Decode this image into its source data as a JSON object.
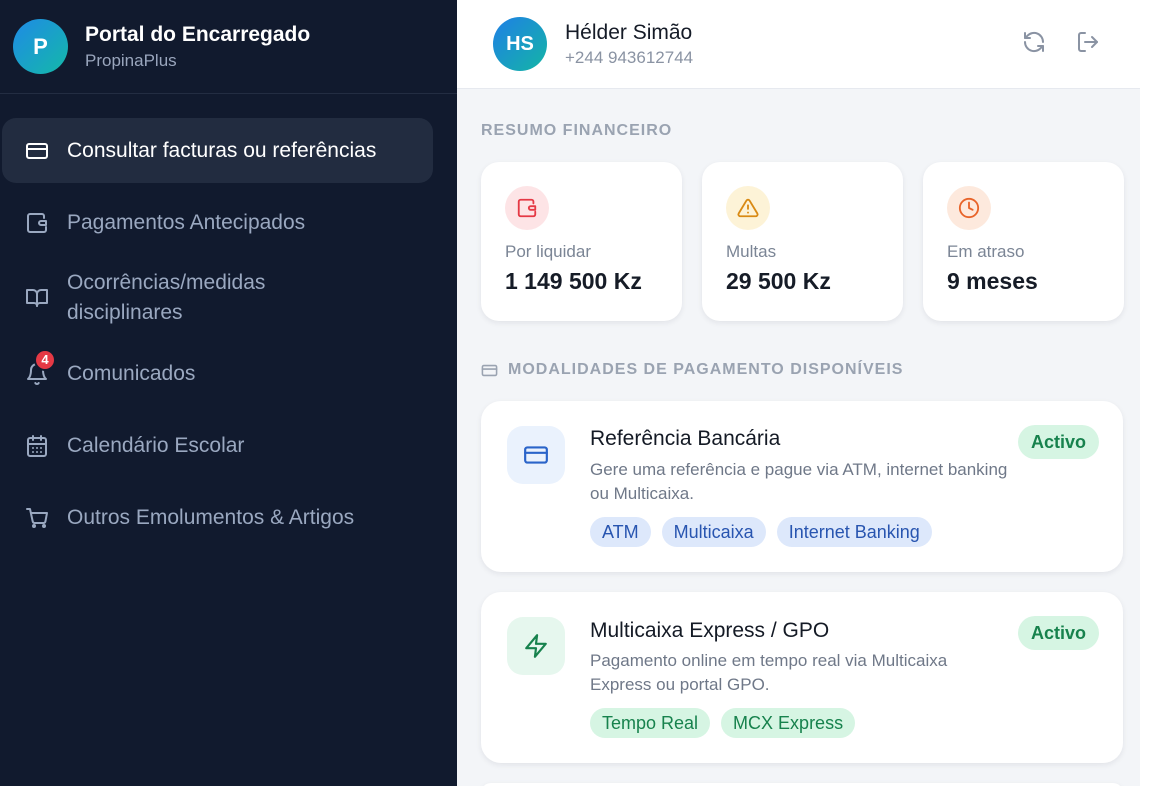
{
  "brand": {
    "logo_letter": "P",
    "title": "Portal do Encarregado",
    "subtitle": "PropinaPlus"
  },
  "sidebar": {
    "items": [
      {
        "label": "Consultar facturas ou referências",
        "icon": "credit-card-icon",
        "active": true
      },
      {
        "label": "Pagamentos Antecipados",
        "icon": "wallet-icon"
      },
      {
        "label_line1": "Ocorrências/medidas",
        "label_line2": "disciplinares",
        "icon": "book-open-icon"
      },
      {
        "label": "Comunicados",
        "icon": "bell-icon",
        "badge": "4"
      },
      {
        "label": "Calendário Escolar",
        "icon": "calendar-icon"
      },
      {
        "label": "Outros Emolumentos & Artigos",
        "icon": "shopping-cart-icon"
      }
    ]
  },
  "header": {
    "avatar_initials": "HS",
    "user_name": "Hélder Simão",
    "user_phone": "+244 943612744",
    "refresh_icon": "refresh-icon",
    "logout_icon": "logout-icon"
  },
  "summary": {
    "title": "RESUMO FINANCEIRO",
    "stats": [
      {
        "label": "Por liquidar",
        "value": "1 149 500 Kz",
        "icon": "wallet-icon",
        "color": "#e53945"
      },
      {
        "label": "Multas",
        "value": "29 500 Kz",
        "icon": "warning-icon",
        "color": "#d98a14"
      },
      {
        "label": "Em atraso",
        "value": "9 meses",
        "icon": "clock-icon",
        "color": "#e8642a"
      }
    ]
  },
  "payment_methods": {
    "title": "MODALIDADES DE PAGAMENTO DISPONÍVEIS",
    "cards": [
      {
        "title": "Referência Bancária",
        "description": "Gere uma referência e pague via ATM, internet banking ou Multicaixa.",
        "status": "Activo",
        "icon": "credit-card-icon",
        "tags": [
          "ATM",
          "Multicaixa",
          "Internet Banking"
        ]
      },
      {
        "title": "Multicaixa Express / GPO",
        "description": "Pagamento online em tempo real via Multicaixa Express ou portal GPO.",
        "status": "Activo",
        "icon": "lightning-icon",
        "tags": [
          "Tempo Real",
          "MCX Express"
        ]
      }
    ]
  },
  "colors": {
    "sidebar_bg": "#111a2e",
    "active_bg": "#222c40",
    "accent_green": "#17824d",
    "accent_blue": "#2855b0"
  }
}
